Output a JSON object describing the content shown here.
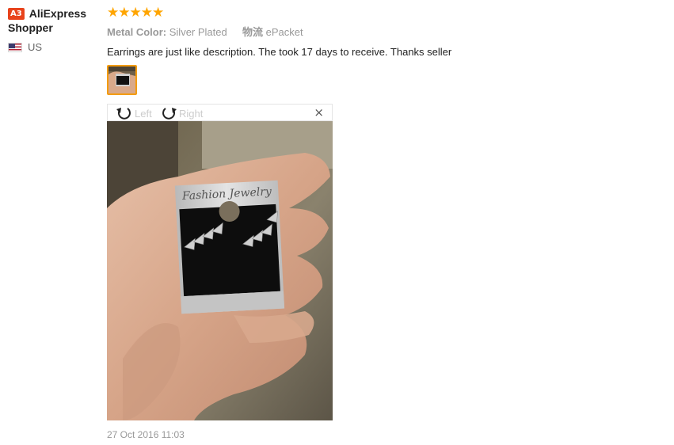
{
  "user": {
    "level_badge": "A3",
    "name_line1": "AliExpress",
    "name_line2": "Shopper",
    "country": "US"
  },
  "review": {
    "rating": 5,
    "stars_text": "★★★★★",
    "attributes": {
      "color_label": "Metal Color:",
      "color_value": "Silver Plated",
      "shipping_label": "物流",
      "shipping_value": "ePacket"
    },
    "text": "Earrings are just like description. The took 17 days to receive. Thanks seller",
    "date": "27 Oct 2016 11:03"
  },
  "viewer": {
    "rotate_left_label": "Left",
    "rotate_right_label": "Right",
    "close_symbol": "×",
    "card_text": "Fashion Jewelry"
  },
  "icons": {
    "rotate_left": "rotate-left-icon",
    "rotate_right": "rotate-right-icon",
    "close": "close-icon",
    "flag": "us-flag-icon"
  },
  "colors": {
    "star": "#ffa500",
    "badge": "#e8431c",
    "thumb_border": "#f39c12"
  }
}
